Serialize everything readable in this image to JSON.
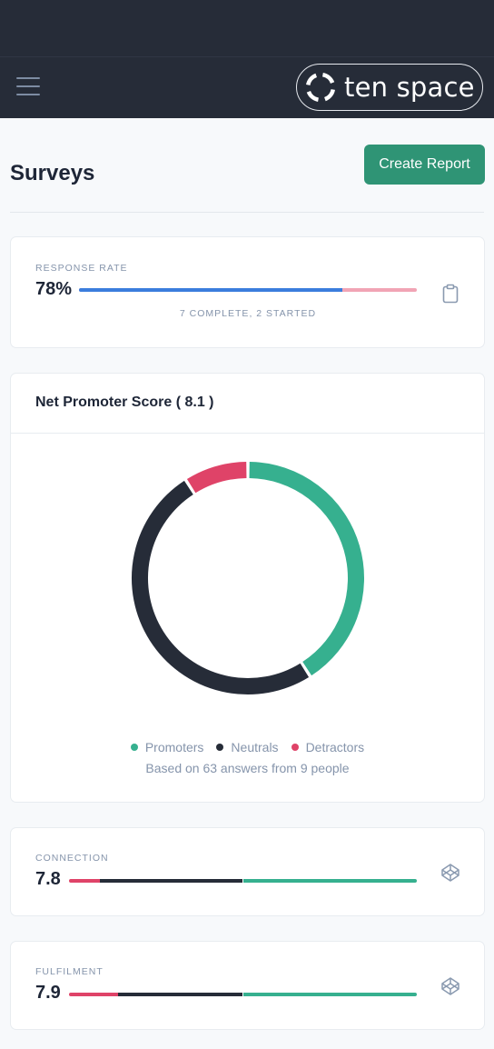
{
  "header": {
    "logo_text": "ten space",
    "menu_icon": "hamburger-icon",
    "bg_color": "#262c38"
  },
  "page": {
    "title": "Surveys",
    "create_report_label": "Create Report",
    "accent_color": "#2f9475"
  },
  "response_rate": {
    "label": "RESPONSE RATE",
    "value": "78%",
    "completion_fraction": 0.78,
    "summary": "7 COMPLETE, 2 STARTED",
    "icon": "clipboard-icon"
  },
  "nps": {
    "title": "Net Promoter Score ( 8.1 )",
    "legend": [
      {
        "label": "Promoters",
        "color": "#36b08f"
      },
      {
        "label": "Neutrals",
        "color": "#262c38"
      },
      {
        "label": "Detractors",
        "color": "#df4368"
      }
    ],
    "footer": "Based on 63 answers from 9 people",
    "chart_data": {
      "type": "pie",
      "categories": [
        "Promoters",
        "Neutrals",
        "Detractors"
      ],
      "values": [
        41,
        50,
        9
      ],
      "colors": [
        "#36b08f",
        "#262c38",
        "#df4368"
      ],
      "style": "donut",
      "legend_position": "bottom"
    }
  },
  "metrics": [
    {
      "label": "CONNECTION",
      "value": "7.8",
      "segments": [
        {
          "name": "Detractors",
          "fraction": 0.09,
          "color": "#df4368"
        },
        {
          "name": "Neutrals",
          "fraction": 0.41,
          "color": "#262c38"
        },
        {
          "name": "Promoters",
          "fraction": 0.5,
          "color": "#36b08f"
        }
      ],
      "icon": "codepen-cube-icon"
    },
    {
      "label": "FULFILMENT",
      "value": "7.9",
      "segments": [
        {
          "name": "Detractors",
          "fraction": 0.14,
          "color": "#df4368"
        },
        {
          "name": "Neutrals",
          "fraction": 0.36,
          "color": "#262c38"
        },
        {
          "name": "Promoters",
          "fraction": 0.5,
          "color": "#36b08f"
        }
      ],
      "icon": "codepen-cube-icon"
    }
  ]
}
